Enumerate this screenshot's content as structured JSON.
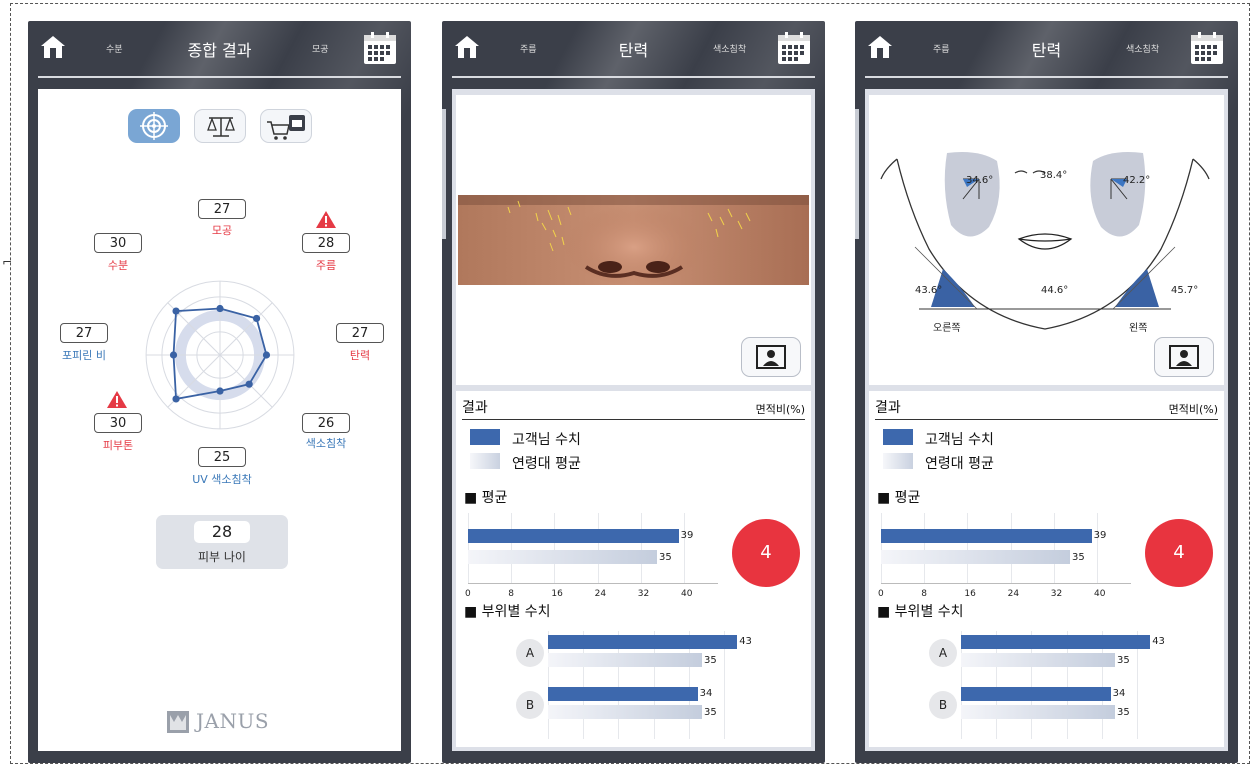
{
  "panel1": {
    "header": {
      "title": "종합 결과",
      "left_sub": "수분",
      "right_sub": "모공"
    },
    "mode_icons": [
      "target-icon",
      "balance-scale-icon",
      "cart-icon"
    ],
    "radar_items": [
      {
        "label": "모공",
        "value": "27",
        "color": "#e53a45",
        "warning": false
      },
      {
        "label": "주름",
        "value": "28",
        "color": "#e53a45",
        "warning": true
      },
      {
        "label": "탄력",
        "value": "27",
        "color": "#e53a45",
        "warning": false
      },
      {
        "label": "색소침착",
        "value": "26",
        "color": "#3a78b8",
        "warning": false
      },
      {
        "label": "UV 색소침착",
        "value": "25",
        "color": "#3a78b8",
        "warning": false
      },
      {
        "label": "피부톤",
        "value": "30",
        "color": "#e53a45",
        "warning": true
      },
      {
        "label": "포피린 비",
        "value": "27",
        "color": "#3a78b8",
        "warning": false
      },
      {
        "label": "수분",
        "value": "30",
        "color": "#e53a45",
        "warning": false
      }
    ],
    "skin_age": {
      "value": "28",
      "label": "피부 나이"
    },
    "brand": "JANUS"
  },
  "panel2": {
    "header": {
      "title": "탄력",
      "left_sub": "주름",
      "right_sub": "색소침착"
    },
    "result_title": "결과",
    "unit": "면적비(%)",
    "legend": {
      "customer": "고객님 수치",
      "age_avg": "연령대 평균"
    },
    "avg_section": "■ 평균",
    "part_section": "■ 부위별 수치",
    "avg": {
      "customer": 39,
      "age_avg": 35
    },
    "axis_ticks": [
      "0",
      "8",
      "16",
      "24",
      "32",
      "40"
    ],
    "score": "4",
    "parts": [
      {
        "name": "A",
        "customer": 43,
        "age_avg": 35
      },
      {
        "name": "B",
        "customer": 34,
        "age_avg": 35
      }
    ]
  },
  "panel3": {
    "header": {
      "title": "탄력",
      "left_sub": "주름",
      "right_sub": "색소침착"
    },
    "face_angles": {
      "right_cheek": "34.6°",
      "center": "38.4°",
      "left_cheek": "42.2°",
      "right_jaw": "43.6°",
      "chin": "44.6°",
      "left_jaw": "45.7°"
    },
    "side_labels": {
      "right": "오른쪽",
      "left": "왼쪽"
    },
    "result_title": "결과",
    "unit": "면적비(%)",
    "legend": {
      "customer": "고객님 수치",
      "age_avg": "연령대 평균"
    },
    "avg_section": "■ 평균",
    "part_section": "■ 부위별 수치",
    "avg": {
      "customer": 39,
      "age_avg": 35
    },
    "axis_ticks": [
      "0",
      "8",
      "16",
      "24",
      "32",
      "40"
    ],
    "score": "4",
    "parts": [
      {
        "name": "A",
        "customer": 43,
        "age_avg": 35
      },
      {
        "name": "B",
        "customer": 34,
        "age_avg": 35
      }
    ]
  },
  "colors": {
    "customer_bar": "#3d68ad",
    "score_circle": "#e8343f",
    "radar_line": "#3a62a4",
    "warning": "#e53a45"
  }
}
